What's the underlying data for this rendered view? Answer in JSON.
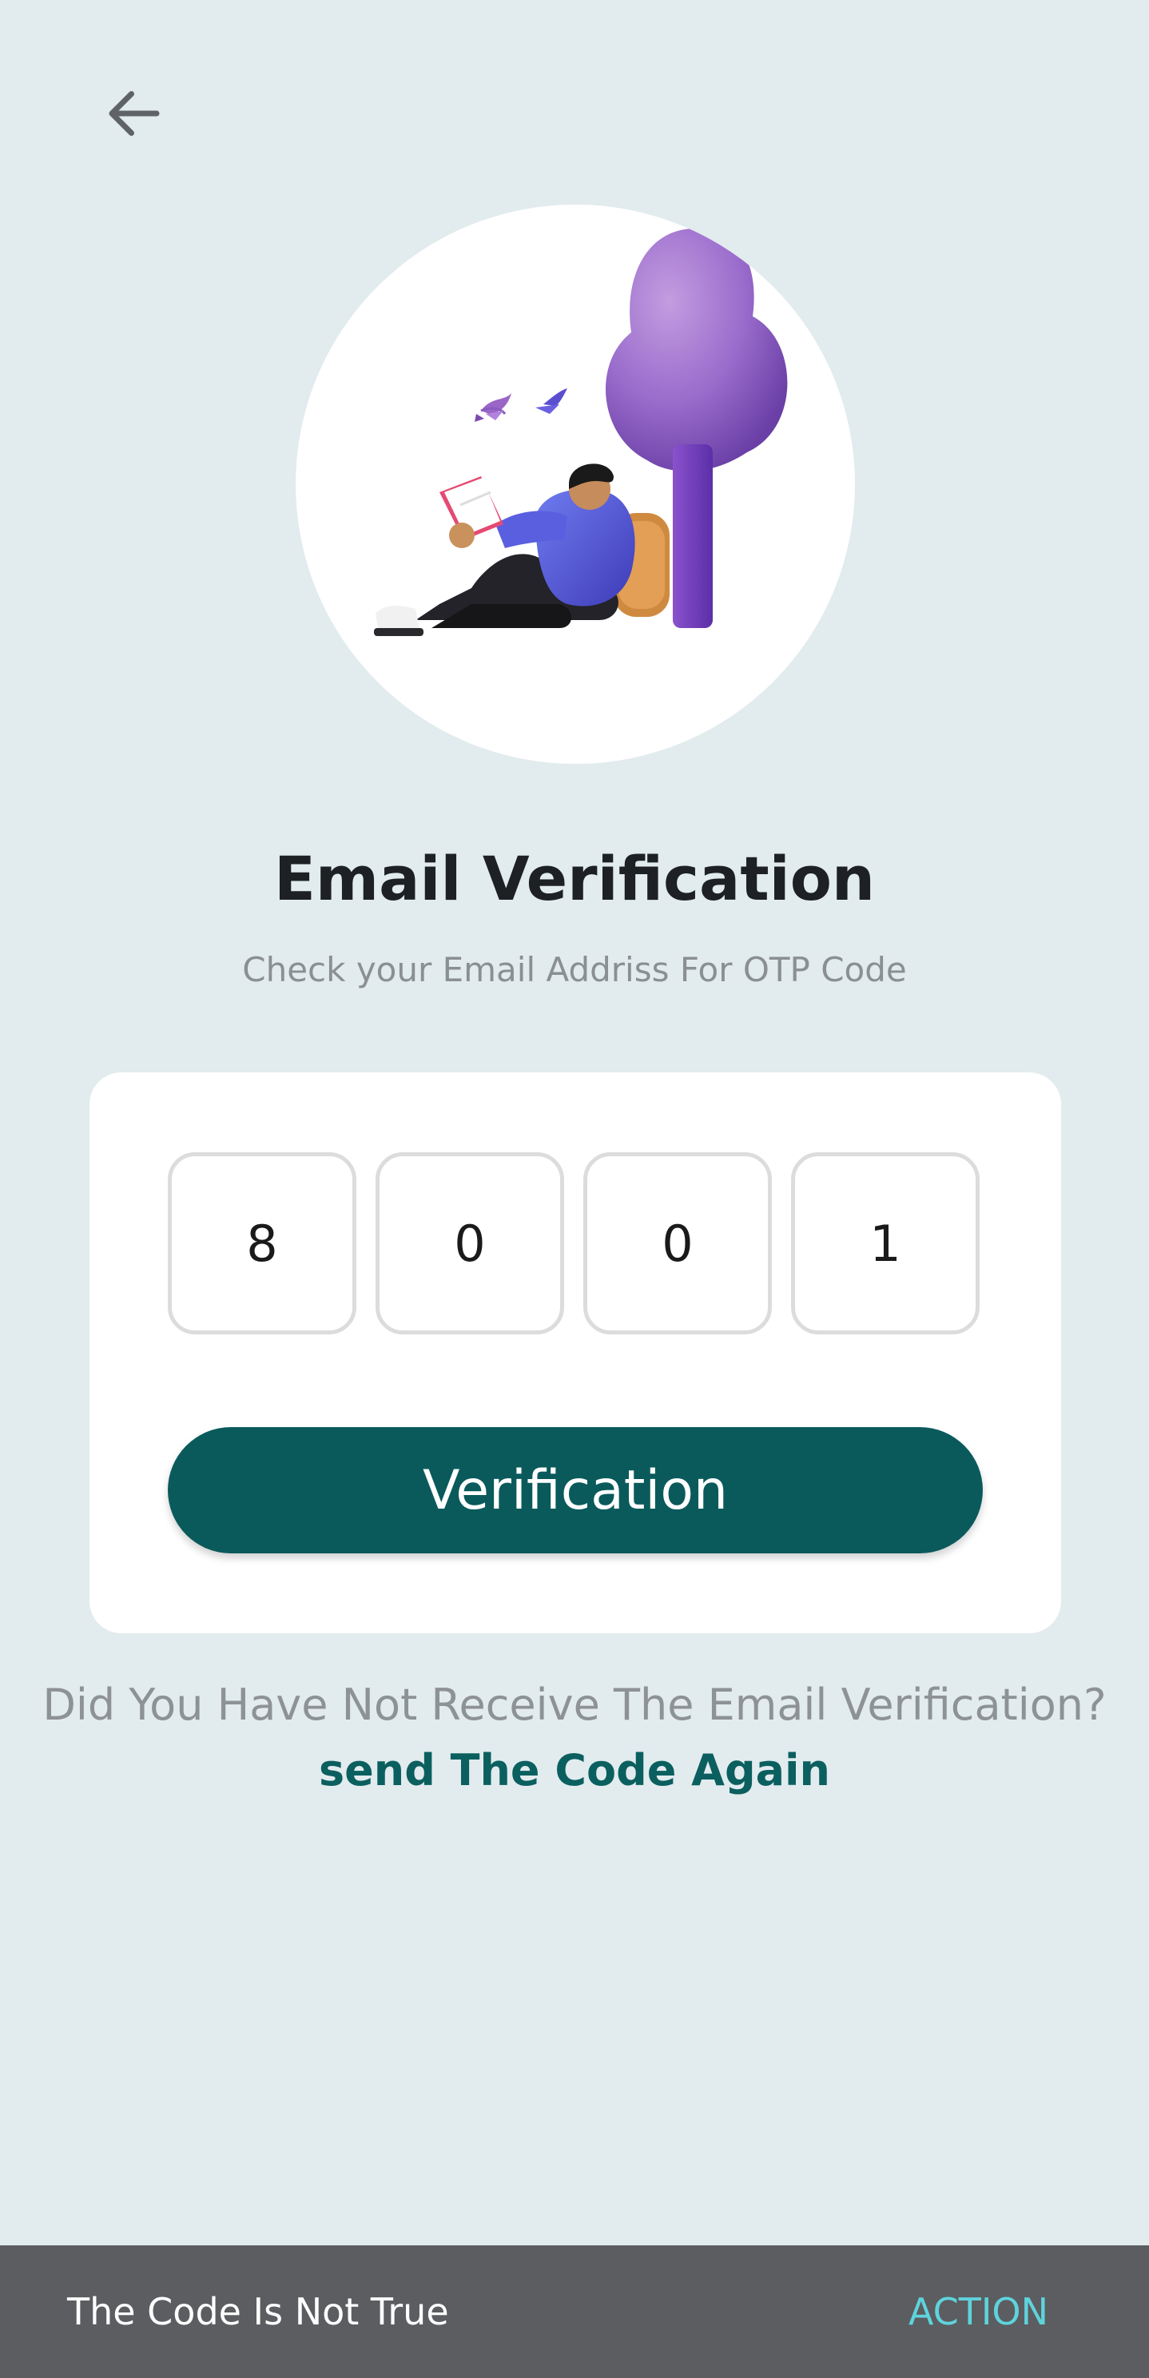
{
  "header": {
    "back_icon": "arrow-left-icon"
  },
  "hero": {
    "illustration": "person-reading-under-tree"
  },
  "page": {
    "title": "Email Verification",
    "subtitle": "Check your Email Addriss For OTP Code"
  },
  "otp": {
    "digits": [
      "8",
      "0",
      "0",
      "1"
    ]
  },
  "actions": {
    "verify_label": "Verification",
    "resend_question": "Did You Have Not Receive The Email Verification?",
    "resend_link": "send The Code Again"
  },
  "snackbar": {
    "message": "The Code Is Not True",
    "action_label": "ACTION"
  },
  "colors": {
    "background": "#e2ebee",
    "primary": "#0a5a5c",
    "snackbar": "#5b5d60",
    "snackbar_action": "#5fd3dc"
  }
}
